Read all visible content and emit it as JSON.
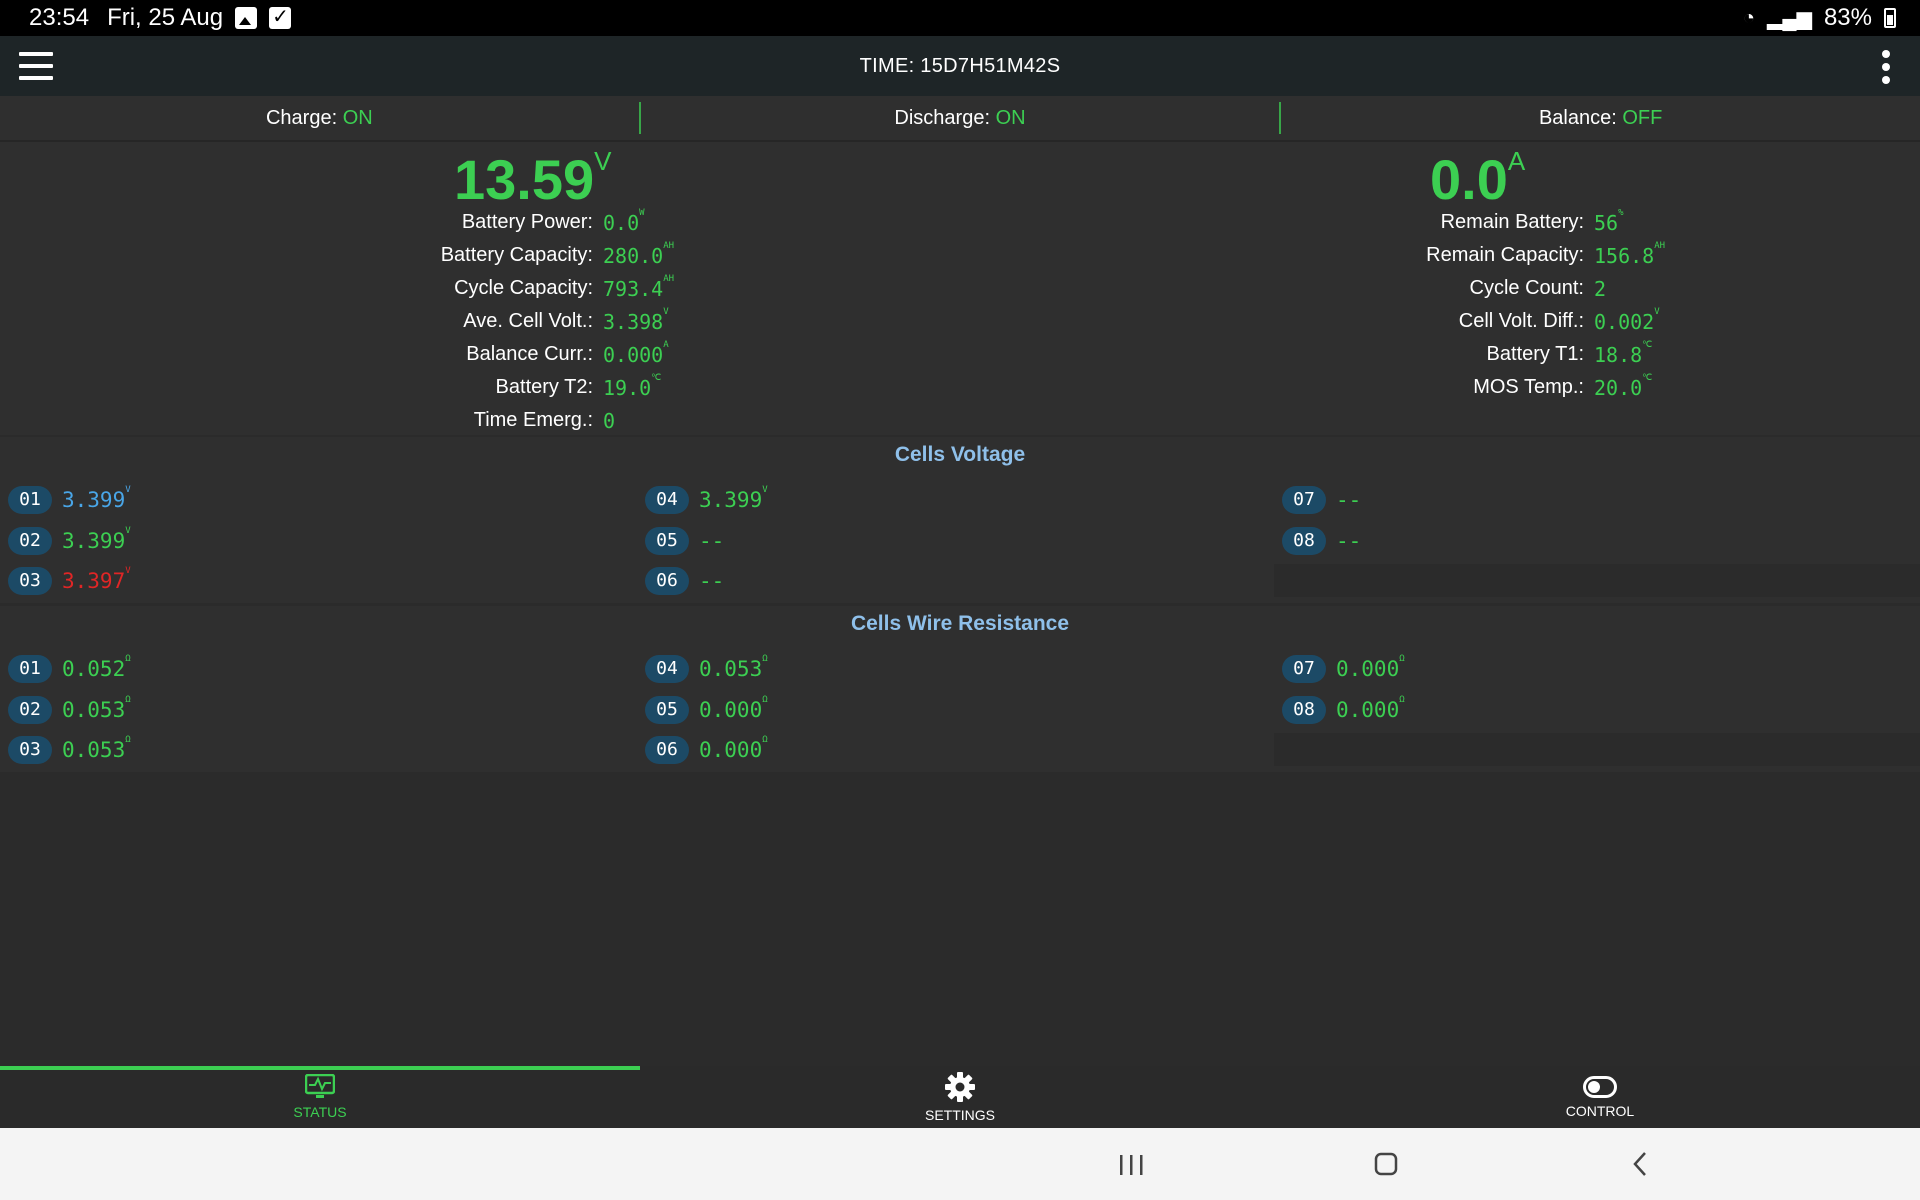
{
  "status_bar": {
    "time": "23:54",
    "date": "Fri, 25 Aug",
    "battery": "83%"
  },
  "app_bar": {
    "title": "TIME: 15D7H51M42S"
  },
  "flags": [
    {
      "label": "Charge:",
      "value": "ON"
    },
    {
      "label": "Discharge:",
      "value": "ON"
    },
    {
      "label": "Balance:",
      "value": "OFF"
    }
  ],
  "summary": {
    "voltage": {
      "value": "13.59",
      "unit": "V"
    },
    "current": {
      "value": "0.0",
      "unit": "A"
    },
    "left": [
      {
        "label": "Battery Power:",
        "value": "0.0",
        "unit": "W"
      },
      {
        "label": "Battery Capacity:",
        "value": "280.0",
        "unit": "AH"
      },
      {
        "label": "Cycle Capacity:",
        "value": "793.4",
        "unit": "AH"
      },
      {
        "label": "Ave. Cell Volt.:",
        "value": "3.398",
        "unit": "V"
      },
      {
        "label": "Balance Curr.:",
        "value": "0.000",
        "unit": "A"
      },
      {
        "label": "Battery T2:",
        "value": "19.0",
        "unit": "℃"
      },
      {
        "label": "Time Emerg.:",
        "value": "0",
        "unit": ""
      }
    ],
    "right": [
      {
        "label": "Remain Battery:",
        "value": "56",
        "unit": "%"
      },
      {
        "label": "Remain Capacity:",
        "value": "156.8",
        "unit": "AH"
      },
      {
        "label": "Cycle Count:",
        "value": "2",
        "unit": ""
      },
      {
        "label": "Cell Volt. Diff.:",
        "value": "0.002",
        "unit": "V"
      },
      {
        "label": "Battery T1:",
        "value": "18.8",
        "unit": "℃"
      },
      {
        "label": "MOS Temp.:",
        "value": "20.0",
        "unit": "℃"
      }
    ]
  },
  "cells_voltage": {
    "title": "Cells Voltage",
    "cells": [
      {
        "id": "01",
        "value": "3.399",
        "unit": "V",
        "tone": "max"
      },
      {
        "id": "02",
        "value": "3.399",
        "unit": "V",
        "tone": "normal"
      },
      {
        "id": "03",
        "value": "3.397",
        "unit": "V",
        "tone": "min"
      },
      {
        "id": "04",
        "value": "3.399",
        "unit": "V",
        "tone": "normal"
      },
      {
        "id": "05",
        "value": "--",
        "unit": "",
        "tone": "normal"
      },
      {
        "id": "06",
        "value": "--",
        "unit": "",
        "tone": "normal"
      },
      {
        "id": "07",
        "value": "--",
        "unit": "",
        "tone": "normal"
      },
      {
        "id": "08",
        "value": "--",
        "unit": "",
        "tone": "normal"
      }
    ]
  },
  "cells_resistance": {
    "title": "Cells Wire Resistance",
    "cells": [
      {
        "id": "01",
        "value": "0.052",
        "unit": "Ω"
      },
      {
        "id": "02",
        "value": "0.053",
        "unit": "Ω"
      },
      {
        "id": "03",
        "value": "0.053",
        "unit": "Ω"
      },
      {
        "id": "04",
        "value": "0.053",
        "unit": "Ω"
      },
      {
        "id": "05",
        "value": "0.000",
        "unit": "Ω"
      },
      {
        "id": "06",
        "value": "0.000",
        "unit": "Ω"
      },
      {
        "id": "07",
        "value": "0.000",
        "unit": "Ω"
      },
      {
        "id": "08",
        "value": "0.000",
        "unit": "Ω"
      }
    ]
  },
  "bottom_nav": [
    {
      "label": "STATUS",
      "icon": "monitor-pulse-icon",
      "active": true
    },
    {
      "label": "SETTINGS",
      "icon": "gear-icon",
      "active": false
    },
    {
      "label": "CONTROL",
      "icon": "toggle-icon",
      "active": false
    }
  ],
  "colors": {
    "accent": "#3ccf52",
    "max_cell": "#49a6e8",
    "min_cell": "#e02626",
    "section_title": "#8fc0ea",
    "cell_badge": "#1c4a66"
  }
}
